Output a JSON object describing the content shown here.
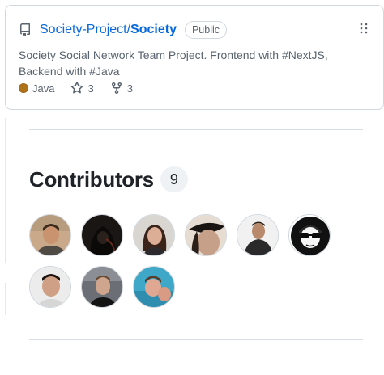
{
  "repo": {
    "owner": "Society-Project",
    "separator": "/",
    "name": "Society",
    "visibility": "Public",
    "description": "Society Social Network Team Project. Frontend with #NextJS, Backend with #Java",
    "language": "Java",
    "language_color": "#b07219",
    "stars": "3",
    "forks": "3"
  },
  "contributors": {
    "heading": "Contributors",
    "count": "9"
  },
  "icons": {
    "repo": "repo-icon",
    "menu": "kebab-menu-icon",
    "star": "star-icon",
    "fork": "fork-icon"
  }
}
